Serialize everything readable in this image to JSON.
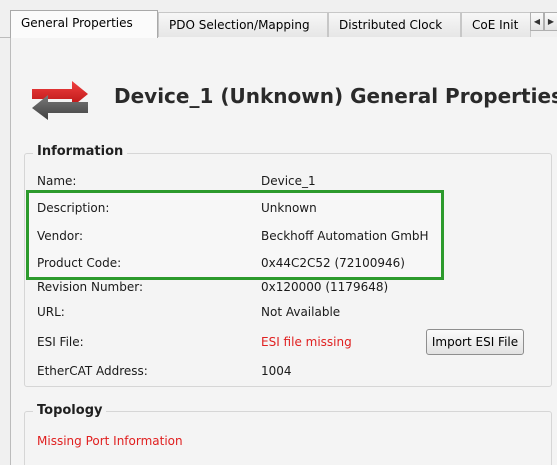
{
  "tabs": [
    {
      "label": "General Properties",
      "active": true
    },
    {
      "label": "PDO Selection/Mapping",
      "active": false
    },
    {
      "label": "Distributed Clock",
      "active": false
    },
    {
      "label": "CoE Init",
      "active": false
    }
  ],
  "tab_scroll": {
    "left_icon": "chevron-left-icon",
    "right_icon": "chevron-right-icon"
  },
  "header": {
    "icon": "transfer-arrows-icon",
    "title": "Device_1 (Unknown) General Properties"
  },
  "information": {
    "title": "Information",
    "rows": [
      {
        "label": "Name:",
        "value": "Device_1"
      },
      {
        "label": "Description:",
        "value": "Unknown"
      },
      {
        "label": "Vendor:",
        "value": "Beckhoff Automation GmbH"
      },
      {
        "label": "Product Code:",
        "value": "0x44C2C52 (72100946)"
      },
      {
        "label": "Revision Number:",
        "value": "0x120000 (1179648)"
      },
      {
        "label": "URL:",
        "value": "Not Available"
      },
      {
        "label": "ESI File:",
        "value": "ESI file missing"
      },
      {
        "label": "EtherCAT Address:",
        "value": "1004"
      }
    ],
    "import_button": "Import ESI File"
  },
  "topology": {
    "title": "Topology",
    "message": "Missing Port Information"
  },
  "colors": {
    "highlight": "#2c9a2c",
    "error_text": "#e02020",
    "arrow_red": "#d42020",
    "arrow_gray": "#5a5a5a"
  }
}
